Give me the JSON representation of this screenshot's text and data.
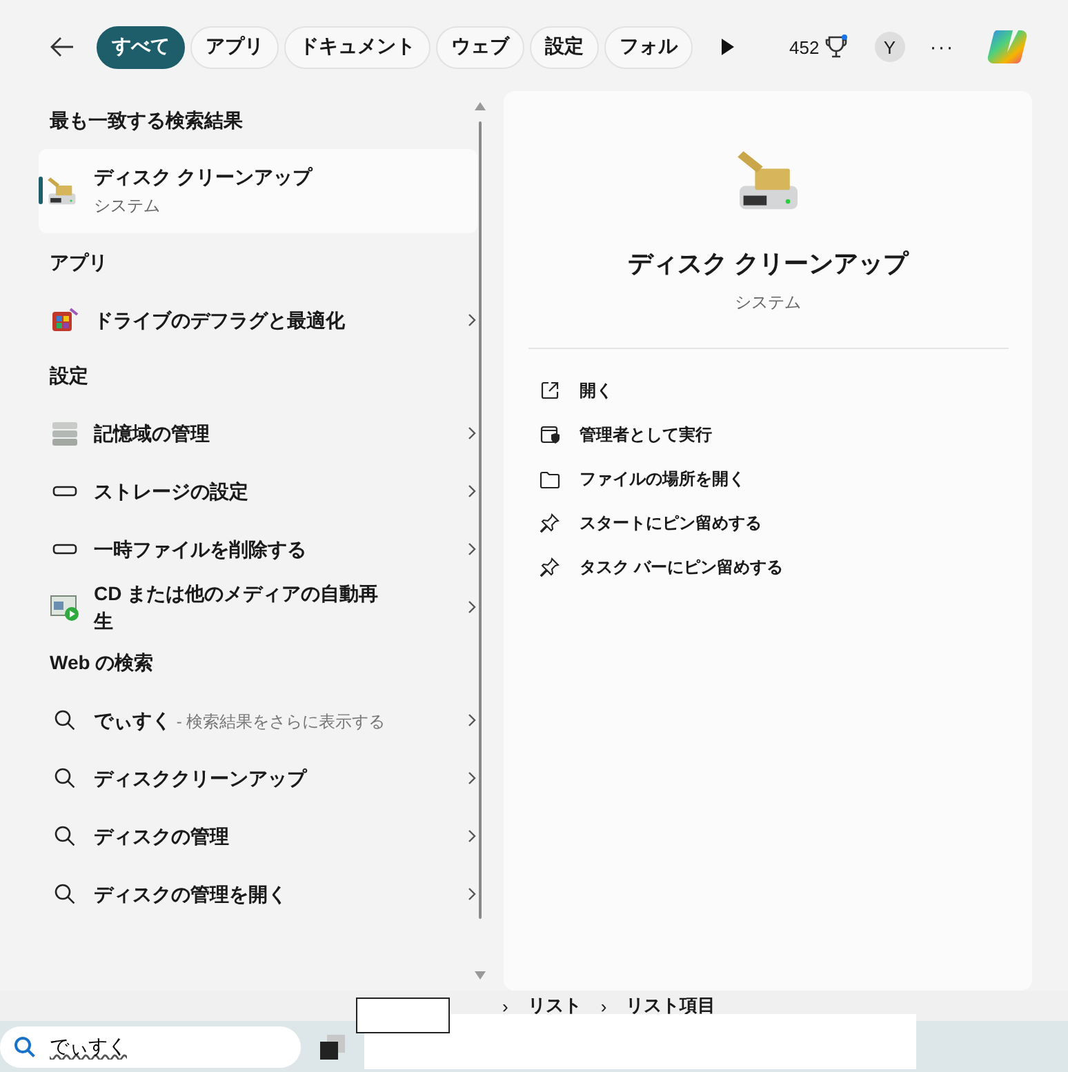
{
  "tabs": [
    {
      "label": "すべて",
      "selected": true
    },
    {
      "label": "アプリ",
      "selected": false
    },
    {
      "label": "ドキュメント",
      "selected": false
    },
    {
      "label": "ウェブ",
      "selected": false
    },
    {
      "label": "設定",
      "selected": false
    },
    {
      "label": "フォル",
      "selected": false
    }
  ],
  "points": "452",
  "avatar": "Y",
  "more": "···",
  "best_match": {
    "heading": "最も一致する検索結果",
    "title": "ディスク クリーンアップ",
    "subtitle": "システム",
    "selected": true
  },
  "groups": [
    {
      "heading": "アプリ",
      "items": [
        {
          "label": "ドライブのデフラグと最適化",
          "kind": "defrag"
        }
      ]
    },
    {
      "heading": "設定",
      "items": [
        {
          "label": "記憶域の管理",
          "kind": "storage"
        },
        {
          "label": "ストレージの設定",
          "kind": "drive"
        },
        {
          "label": "一時ファイルを削除する",
          "kind": "drive"
        },
        {
          "label": "CD または他のメディアの自動再生",
          "kind": "autoplay"
        }
      ]
    },
    {
      "heading": "Web の検索",
      "items": [
        {
          "label": "でぃすく",
          "note": "- 検索結果をさらに表示する",
          "kind": "search"
        },
        {
          "label": "ディスククリーンアップ",
          "kind": "search"
        },
        {
          "label": "ディスクの管理",
          "kind": "search"
        },
        {
          "label": "ディスクの管理を開く",
          "kind": "search"
        }
      ]
    }
  ],
  "detail": {
    "title": "ディスク クリーンアップ",
    "subtitle": "システム",
    "actions": [
      {
        "label": "開く",
        "kind": "open"
      },
      {
        "label": "管理者として実行",
        "kind": "admin"
      },
      {
        "label": "ファイルの場所を開く",
        "kind": "folder"
      },
      {
        "label": "スタートにピン留めする",
        "kind": "pin"
      },
      {
        "label": "タスク バーにピン留めする",
        "kind": "pin"
      }
    ]
  },
  "breadcrumb": [
    {
      "separator": "›",
      "label": "リスト"
    },
    {
      "separator": "›",
      "label": "リスト項目"
    }
  ],
  "search": {
    "value": "でぃすく"
  }
}
